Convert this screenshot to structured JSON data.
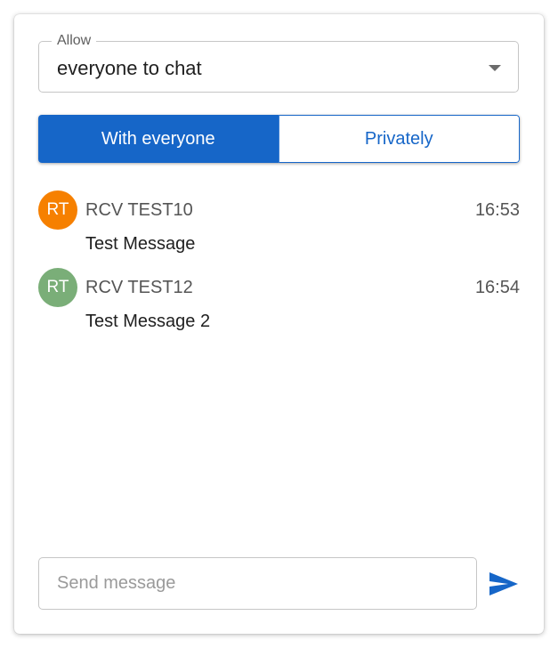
{
  "allow_select": {
    "legend": "Allow",
    "value": "everyone to chat",
    "icon": "chevron-down-icon"
  },
  "audience_toggle": {
    "options": [
      {
        "label": "With everyone",
        "selected": true
      },
      {
        "label": "Privately",
        "selected": false
      }
    ],
    "active_color": "#1666c8"
  },
  "messages": [
    {
      "initials": "RT",
      "avatar_color": "#f68000",
      "sender": "RCV TEST10",
      "time": "16:53",
      "text": "Test Message"
    },
    {
      "initials": "RT",
      "avatar_color": "#7aae78",
      "sender": "RCV TEST12",
      "time": "16:54",
      "text": "Test Message 2"
    }
  ],
  "composer": {
    "placeholder": "Send message",
    "value": "",
    "send_icon": "send-icon",
    "send_color": "#1666c8"
  }
}
